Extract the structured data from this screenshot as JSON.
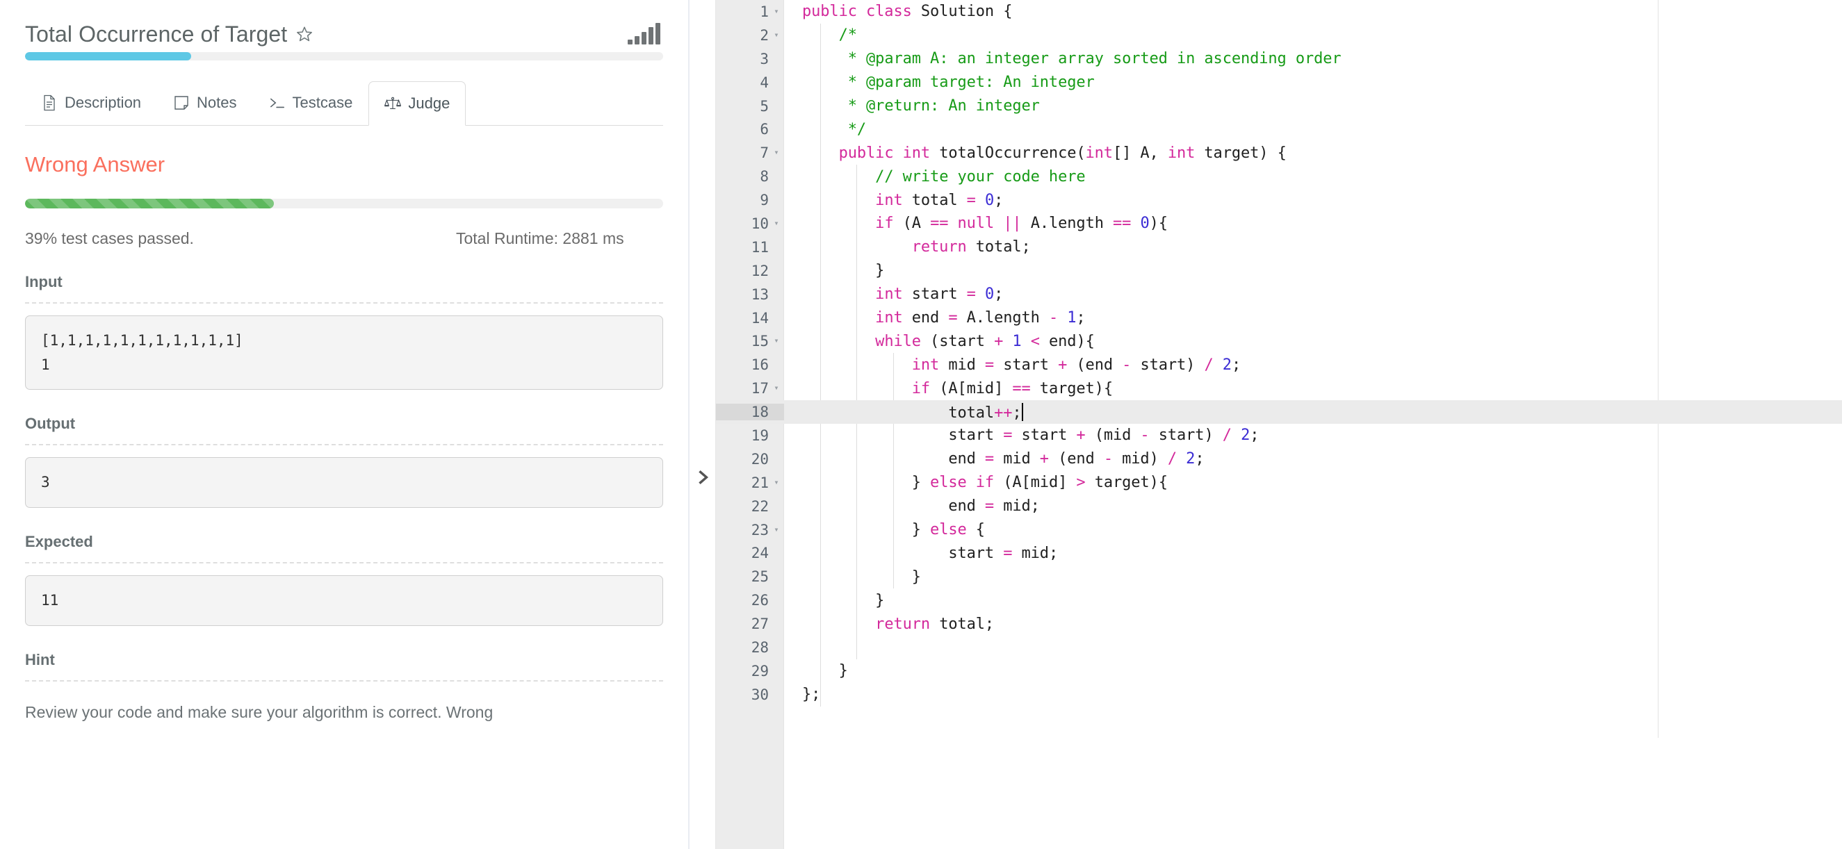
{
  "problem": {
    "title": "Total Occurrence of Target",
    "star_icon": "star-outline-icon",
    "chart_icon": "bar-chart-icon",
    "progress_percent": 26
  },
  "tabs": [
    {
      "id": "description",
      "label": "Description",
      "icon": "document-icon",
      "active": false
    },
    {
      "id": "notes",
      "label": "Notes",
      "icon": "note-icon",
      "active": false
    },
    {
      "id": "testcase",
      "label": "Testcase",
      "icon": "terminal-icon",
      "active": false
    },
    {
      "id": "judge",
      "label": "Judge",
      "icon": "scales-icon",
      "active": true
    }
  ],
  "judge": {
    "verdict": "Wrong Answer",
    "verdict_color": "#fa6f5d",
    "pass_percent": 39,
    "pass_bar_color": "#5cb85c",
    "pass_text": "39% test cases passed.",
    "runtime_text": "Total Runtime: 2881 ms",
    "sections": [
      {
        "label": "Input",
        "value": "[1,1,1,1,1,1,1,1,1,1,1]\n1"
      },
      {
        "label": "Output",
        "value": "3"
      },
      {
        "label": "Expected",
        "value": "11"
      }
    ],
    "hint_label": "Hint",
    "hint_text": "Review your code and make sure your algorithm is correct. Wrong"
  },
  "divider": {
    "icon": "chevron-right-icon"
  },
  "editor": {
    "active_line": 18,
    "cursor_line": 18,
    "syntax_colors": {
      "keyword": "#d3299b",
      "number": "#3b2cd4",
      "comment": "#179b17",
      "text": "#1f1f1f"
    },
    "lines": [
      {
        "n": 1,
        "fold": true,
        "html": "<span class=\"kw\">public class</span> Solution {"
      },
      {
        "n": 2,
        "fold": true,
        "html": "    <span class=\"cmt\">/*</span>"
      },
      {
        "n": 3,
        "fold": false,
        "html": "    <span class=\"cmt\"> * @param A: an integer array sorted in ascending order</span>"
      },
      {
        "n": 4,
        "fold": false,
        "html": "    <span class=\"cmt\"> * @param target: An integer</span>"
      },
      {
        "n": 5,
        "fold": false,
        "html": "    <span class=\"cmt\"> * @return: An integer</span>"
      },
      {
        "n": 6,
        "fold": false,
        "html": "    <span class=\"cmt\"> */</span>"
      },
      {
        "n": 7,
        "fold": true,
        "html": "    <span class=\"kw\">public int</span> totalOccurrence(<span class=\"kw\">int</span>[] A, <span class=\"kw\">int</span> target) {"
      },
      {
        "n": 8,
        "fold": false,
        "html": "        <span class=\"cmt\">// write your code here</span>"
      },
      {
        "n": 9,
        "fold": false,
        "html": "        <span class=\"kw\">int</span> total <span class=\"op\">=</span> <span class=\"num\">0</span>;"
      },
      {
        "n": 10,
        "fold": true,
        "html": "        <span class=\"kw\">if</span> (A <span class=\"op\">==</span> <span class=\"kw\">null</span> <span class=\"op\">||</span> A.length <span class=\"op\">==</span> <span class=\"num\">0</span>){"
      },
      {
        "n": 11,
        "fold": false,
        "html": "            <span class=\"kw\">return</span> total;"
      },
      {
        "n": 12,
        "fold": false,
        "html": "        }"
      },
      {
        "n": 13,
        "fold": false,
        "html": "        <span class=\"kw\">int</span> start <span class=\"op\">=</span> <span class=\"num\">0</span>;"
      },
      {
        "n": 14,
        "fold": false,
        "html": "        <span class=\"kw\">int</span> end <span class=\"op\">=</span> A.length <span class=\"op\">-</span> <span class=\"num\">1</span>;"
      },
      {
        "n": 15,
        "fold": true,
        "html": "        <span class=\"kw\">while</span> (start <span class=\"op\">+</span> <span class=\"num\">1</span> <span class=\"op\">&lt;</span> end){"
      },
      {
        "n": 16,
        "fold": false,
        "html": "            <span class=\"kw\">int</span> mid <span class=\"op\">=</span> start <span class=\"op\">+</span> (end <span class=\"op\">-</span> start) <span class=\"op\">/</span> <span class=\"num\">2</span>;"
      },
      {
        "n": 17,
        "fold": true,
        "html": "            <span class=\"kw\">if</span> (A[mid] <span class=\"op\">==</span> target){"
      },
      {
        "n": 18,
        "fold": false,
        "html": "                total<span class=\"op\">++</span>;<span class=\"cursor\"></span>"
      },
      {
        "n": 19,
        "fold": false,
        "html": "                start <span class=\"op\">=</span> start <span class=\"op\">+</span> (mid <span class=\"op\">-</span> start) <span class=\"op\">/</span> <span class=\"num\">2</span>;"
      },
      {
        "n": 20,
        "fold": false,
        "html": "                end <span class=\"op\">=</span> mid <span class=\"op\">+</span> (end <span class=\"op\">-</span> mid) <span class=\"op\">/</span> <span class=\"num\">2</span>;"
      },
      {
        "n": 21,
        "fold": true,
        "html": "            } <span class=\"kw\">else if</span> (A[mid] <span class=\"op\">&gt;</span> target){"
      },
      {
        "n": 22,
        "fold": false,
        "html": "                end <span class=\"op\">=</span> mid;"
      },
      {
        "n": 23,
        "fold": true,
        "html": "            } <span class=\"kw\">else</span> {"
      },
      {
        "n": 24,
        "fold": false,
        "html": "                start <span class=\"op\">=</span> mid;"
      },
      {
        "n": 25,
        "fold": false,
        "html": "            }"
      },
      {
        "n": 26,
        "fold": false,
        "html": "        }"
      },
      {
        "n": 27,
        "fold": false,
        "html": "        <span class=\"kw\">return</span> total;"
      },
      {
        "n": 28,
        "fold": false,
        "html": ""
      },
      {
        "n": 29,
        "fold": false,
        "html": "    }"
      },
      {
        "n": 30,
        "fold": false,
        "html": "};"
      }
    ]
  }
}
